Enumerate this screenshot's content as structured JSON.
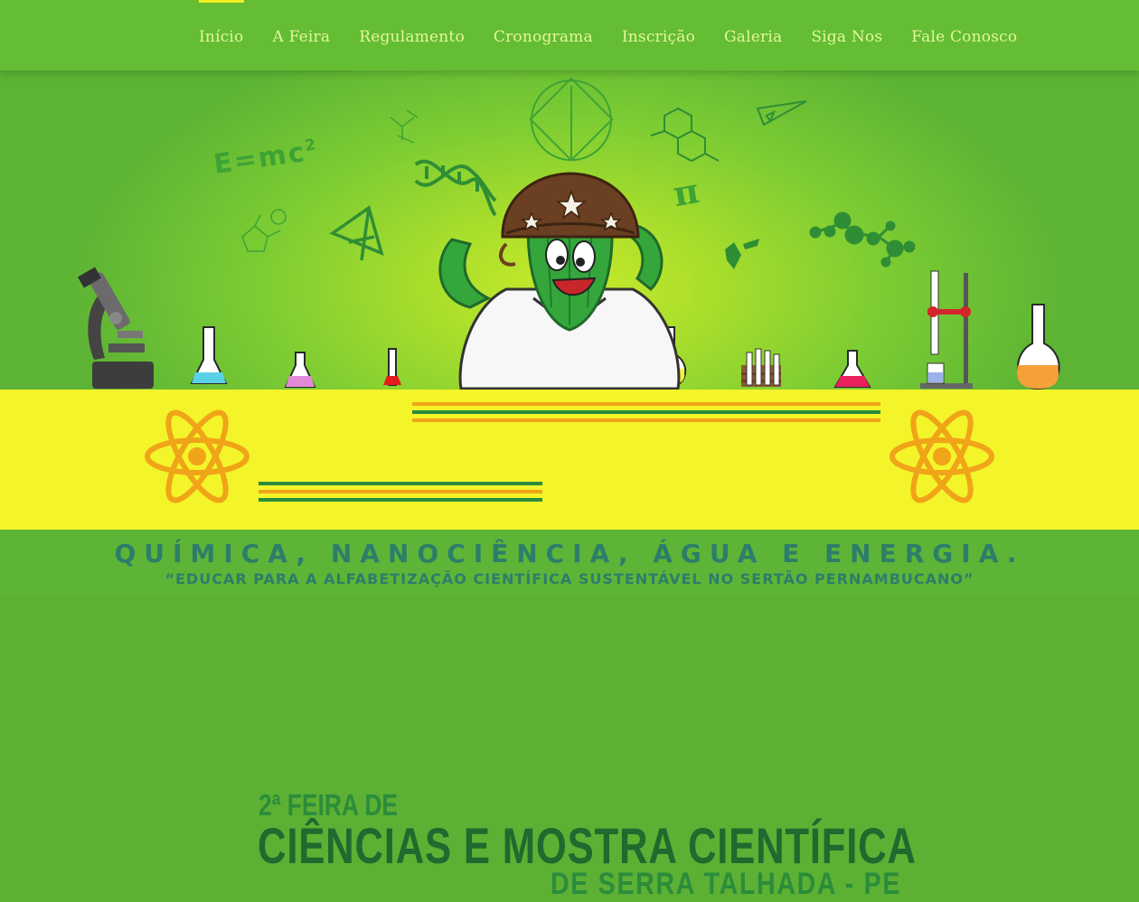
{
  "nav": {
    "items": [
      {
        "label": "Início",
        "active": true
      },
      {
        "label": "A Feira"
      },
      {
        "label": "Regulamento"
      },
      {
        "label": "Cronograma"
      },
      {
        "label": "Inscrição"
      },
      {
        "label": "Galeria"
      },
      {
        "label": "Siga Nos"
      },
      {
        "label": "Fale Conosco"
      }
    ]
  },
  "hero": {
    "formula": "E=mc",
    "formula_exp": "2",
    "pi": "π"
  },
  "banner": {
    "line1": "2ª FEIRA DE",
    "line2": "CIÊNCIAS E MOSTRA CIENTÍFICA",
    "line3": "DE SERRA TALHADA - PE"
  },
  "tagline": {
    "topics": "QUÍMICA, NANOCIÊNCIA, ÁGUA E ENERGIA.",
    "motto": "“EDUCAR PARA A ALFABETIZAÇÃO CIENTÍFICA SUSTENTÁVEL NO SERTÃO PERNAMBUCANO”"
  },
  "colors": {
    "nav_bg": "#64bd33",
    "nav_text": "#e4f79a",
    "active_marker": "#f2f020",
    "banner_bg": "#f3f42a",
    "title_green": "#1f6a2e",
    "atom_orange": "#f0a418",
    "tagline_teal": "#2c7e6a"
  }
}
